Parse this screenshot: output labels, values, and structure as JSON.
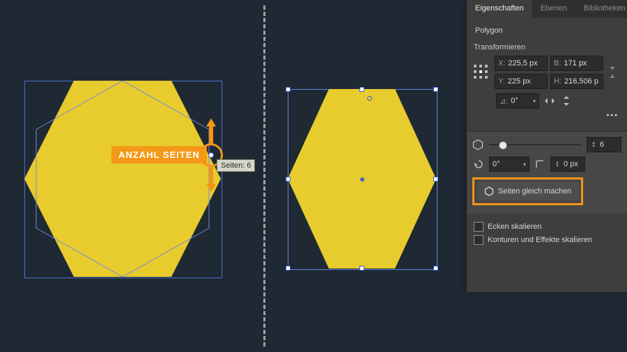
{
  "panel": {
    "tabs": {
      "properties": "Eigenschaften",
      "layers": "Ebenen",
      "libraries": "Bibliotheken"
    },
    "shape_name": "Polygon",
    "transform": {
      "heading": "Transformieren",
      "x_label": "X:",
      "x_value": "225,5 px",
      "y_label": "Y:",
      "y_value": "225 px",
      "w_label": "B:",
      "w_value": "171 px",
      "h_label": "H:",
      "h_value": "216,506 p",
      "angle_label": "⊿:",
      "angle_value": "0°"
    },
    "shape_opts": {
      "sides_value": "6",
      "rotate_value": "0°",
      "corner_value": "0 px",
      "equal_sides_label": "Seiten gleich machen"
    },
    "scale_corners_label": "Ecken skalieren",
    "scale_effects_label": "Konturen und Effekte skalieren"
  },
  "annotation": {
    "label": "ANZAHL SEITEN",
    "tooltip": "Seiten: 6"
  }
}
